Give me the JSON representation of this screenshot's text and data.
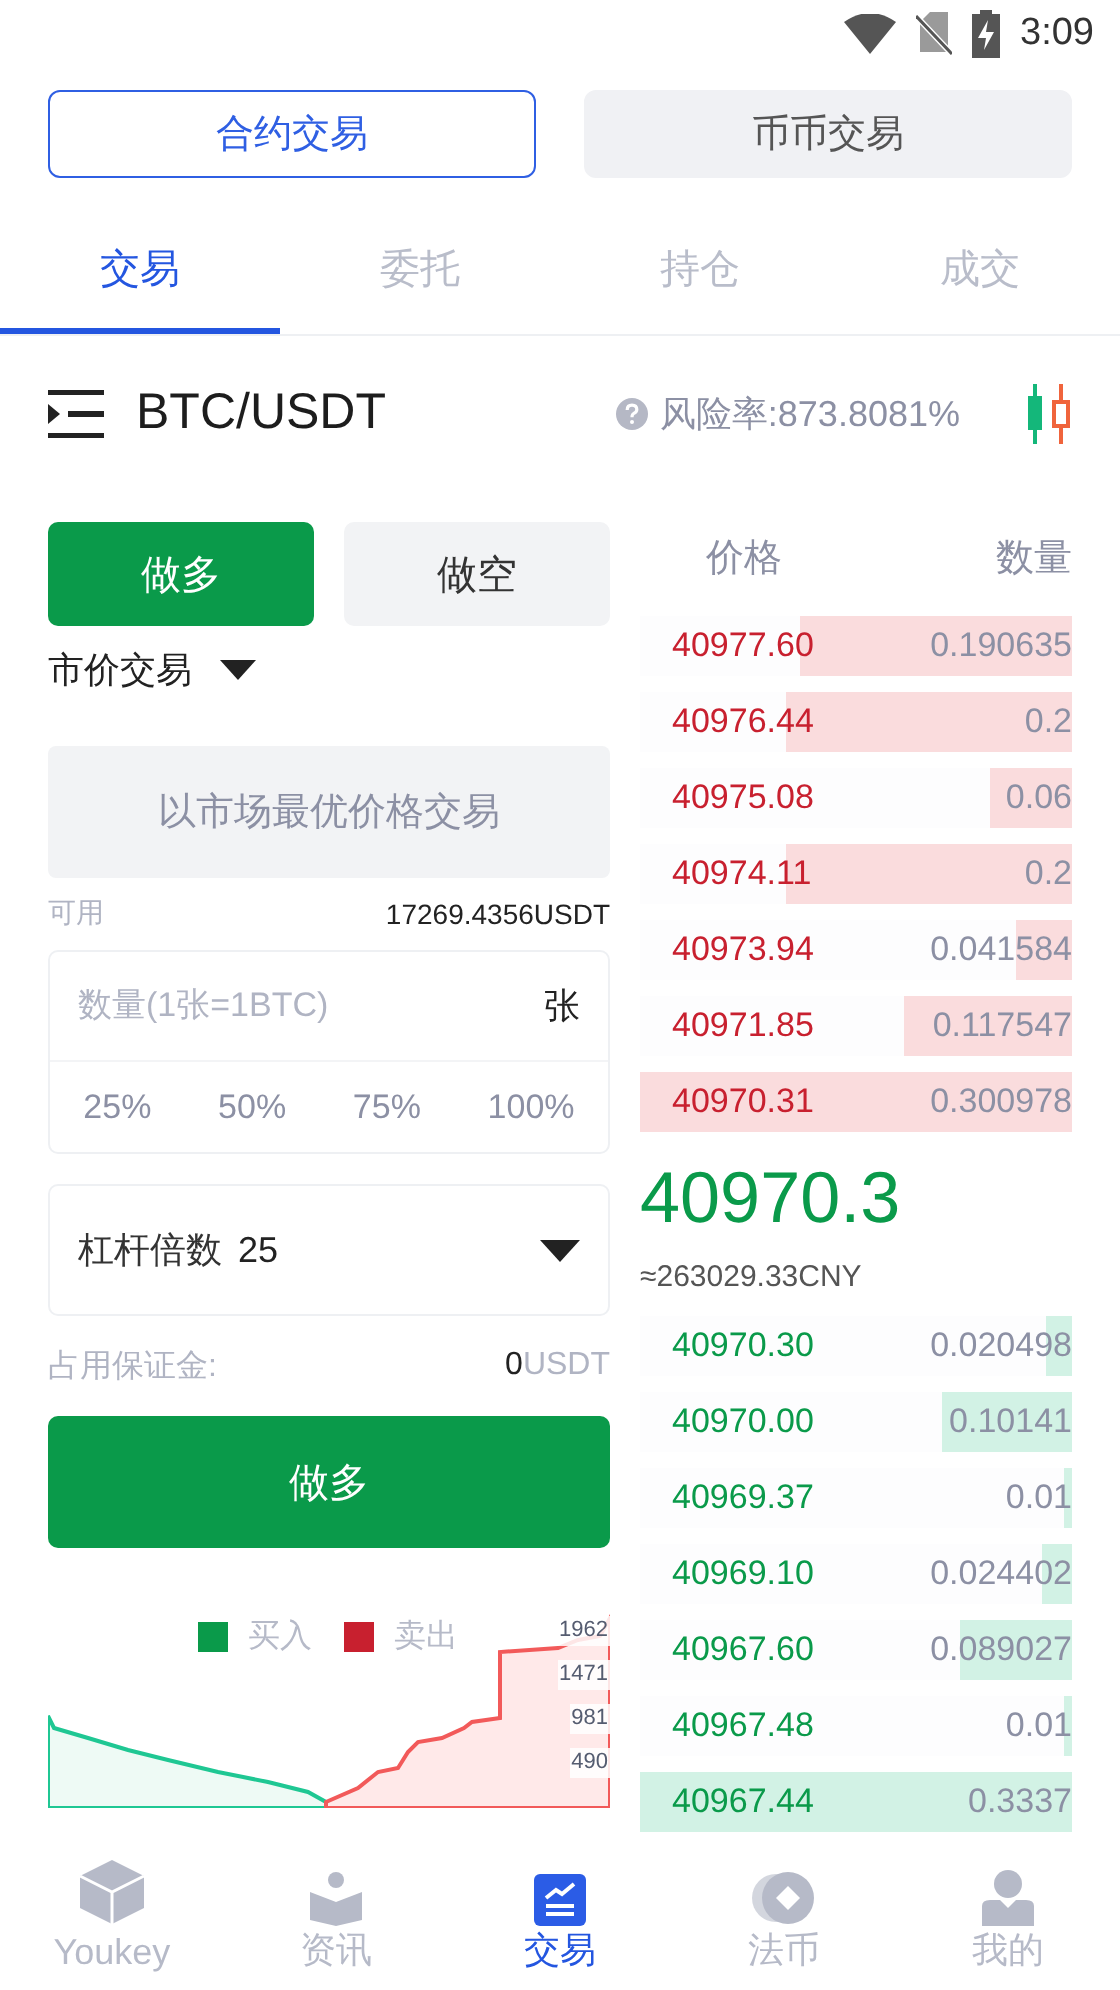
{
  "status_bar": {
    "time": "3:09"
  },
  "mode_switch": [
    {
      "label": "合约交易",
      "selected": true
    },
    {
      "label": "币币交易",
      "selected": false
    }
  ],
  "tabs": [
    {
      "label": "交易",
      "selected": true
    },
    {
      "label": "委托",
      "selected": false
    },
    {
      "label": "持仓",
      "selected": false
    },
    {
      "label": "成交",
      "selected": false
    }
  ],
  "pair": {
    "symbol": "BTC/USDT",
    "risk_rate": "风险率:873.8081%"
  },
  "order_form": {
    "sides": [
      {
        "label": "做多",
        "selected": true
      },
      {
        "label": "做空",
        "selected": false
      }
    ],
    "order_type": "市价交易",
    "price_hint": "以市场最优价格交易",
    "available_label": "可用",
    "available_value": "17269.4356USDT",
    "quantity": {
      "placeholder": "数量(1张=1BTC)",
      "unit": "张"
    },
    "percents": [
      "25%",
      "50%",
      "75%",
      "100%"
    ],
    "leverage": {
      "label": "杠杆倍数",
      "value": "25"
    },
    "margin": {
      "label": "占用保证金:",
      "value": "0",
      "unit": "USDT"
    },
    "submit": "做多"
  },
  "depth_chart": {
    "legend": [
      {
        "label": "买入",
        "color": "#0a9a4a"
      },
      {
        "label": "卖出",
        "color": "#c8202f"
      }
    ],
    "axis_labels": [
      "1962",
      "1471",
      "981",
      "490"
    ]
  },
  "order_book": {
    "columns": [
      "价格",
      "数量"
    ],
    "asks": [
      {
        "price": "40977.60",
        "amount": "0.190635",
        "level": 0.63
      },
      {
        "price": "40976.44",
        "amount": "0.2",
        "level": 0.66
      },
      {
        "price": "40975.08",
        "amount": "0.06",
        "level": 0.19
      },
      {
        "price": "40974.11",
        "amount": "0.2",
        "level": 0.66
      },
      {
        "price": "40973.94",
        "amount": "0.041584",
        "level": 0.13
      },
      {
        "price": "40971.85",
        "amount": "0.117547",
        "level": 0.39
      },
      {
        "price": "40970.31",
        "amount": "0.300978",
        "level": 1
      }
    ],
    "last_price": "40970.3",
    "cny_price": "≈263029.33CNY",
    "bids": [
      {
        "price": "40970.30",
        "amount": "0.020498",
        "level": 0.06
      },
      {
        "price": "40970.00",
        "amount": "0.10141",
        "level": 0.3
      },
      {
        "price": "40969.37",
        "amount": "0.01",
        "level": 0.02
      },
      {
        "price": "40969.10",
        "amount": "0.024402",
        "level": 0.07
      },
      {
        "price": "40967.60",
        "amount": "0.089027",
        "level": 0.26
      },
      {
        "price": "40967.48",
        "amount": "0.01",
        "level": 0.02
      },
      {
        "price": "40967.44",
        "amount": "0.3337",
        "level": 1
      }
    ]
  },
  "nav": [
    {
      "label": "Youkey",
      "selected": false
    },
    {
      "label": "资讯",
      "selected": false
    },
    {
      "label": "交易",
      "selected": true
    },
    {
      "label": "法币",
      "selected": false
    },
    {
      "label": "我的",
      "selected": false
    }
  ]
}
